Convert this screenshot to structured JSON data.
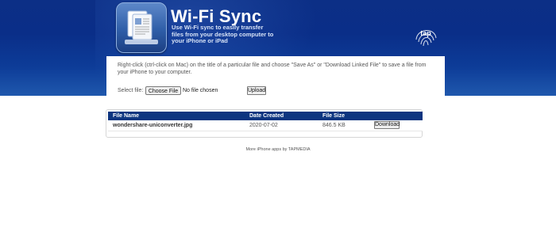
{
  "header": {
    "title": "Wi-Fi Sync",
    "description": "Use Wi-Fi sync to easily transfer files from your desktop computer to your iPhone or iPad",
    "app_icon": "document-sync-icon",
    "logo": {
      "name": "tap-logo",
      "text": "tap"
    },
    "colors": {
      "banner_dark": "#0c2f86",
      "banner_light": "#1f58ad"
    }
  },
  "instructions": "Right-click (ctrl-click on Mac) on the title of a particular file and choose \"Save As\" or \"Download Linked File\" to save a file from your iPhone to your computer.",
  "upload_form": {
    "select_label": "Select file:",
    "choose_button": "Choose File",
    "no_file_text": "No file chosen",
    "upload_button": "Upload"
  },
  "files_table": {
    "header_color": "#0d3580",
    "columns": [
      "File Name",
      "Date Created",
      "File Size"
    ],
    "rows": [
      {
        "name": "wondershare-uniconverter.jpg",
        "date": "2020-07-02",
        "size": "846.5 KB",
        "action": "Download"
      }
    ]
  },
  "footer": "More iPhone apps by TAPMEDIA"
}
